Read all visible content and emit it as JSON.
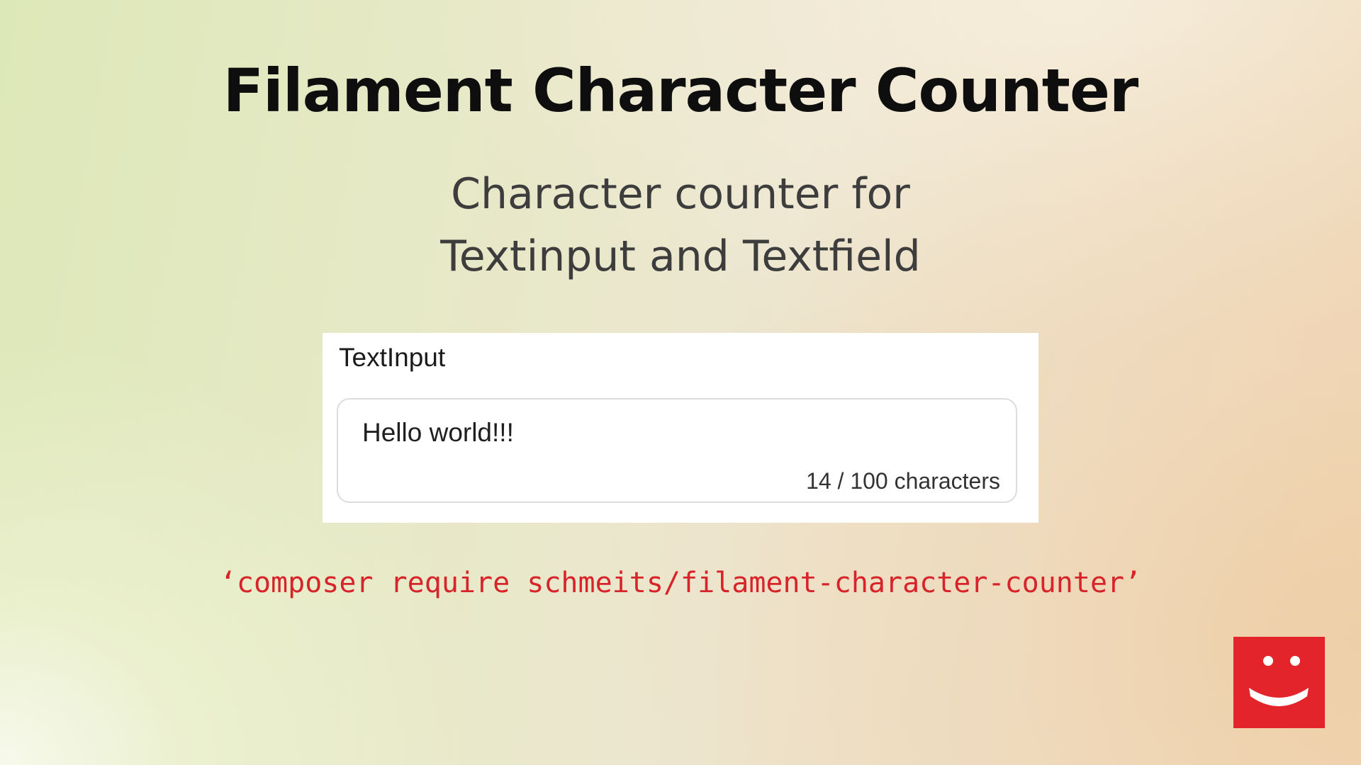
{
  "slide": {
    "title": "Filament Character Counter",
    "subtitle_lines": [
      "Character counter for",
      "Textinput and Textfield"
    ]
  },
  "demo": {
    "label": "TextInput",
    "input_value": "Hello world!!!",
    "counter_text": "14 / 100 characters",
    "count": 14,
    "max": 100
  },
  "command": "‘composer require schmeits/filament-character-counter’",
  "logo": {
    "icon": "smiley-face-icon",
    "color": "#e3242b"
  },
  "colors": {
    "accent": "#d7242a",
    "title": "#0e0e0e",
    "subtitle": "#3d3d3d"
  }
}
